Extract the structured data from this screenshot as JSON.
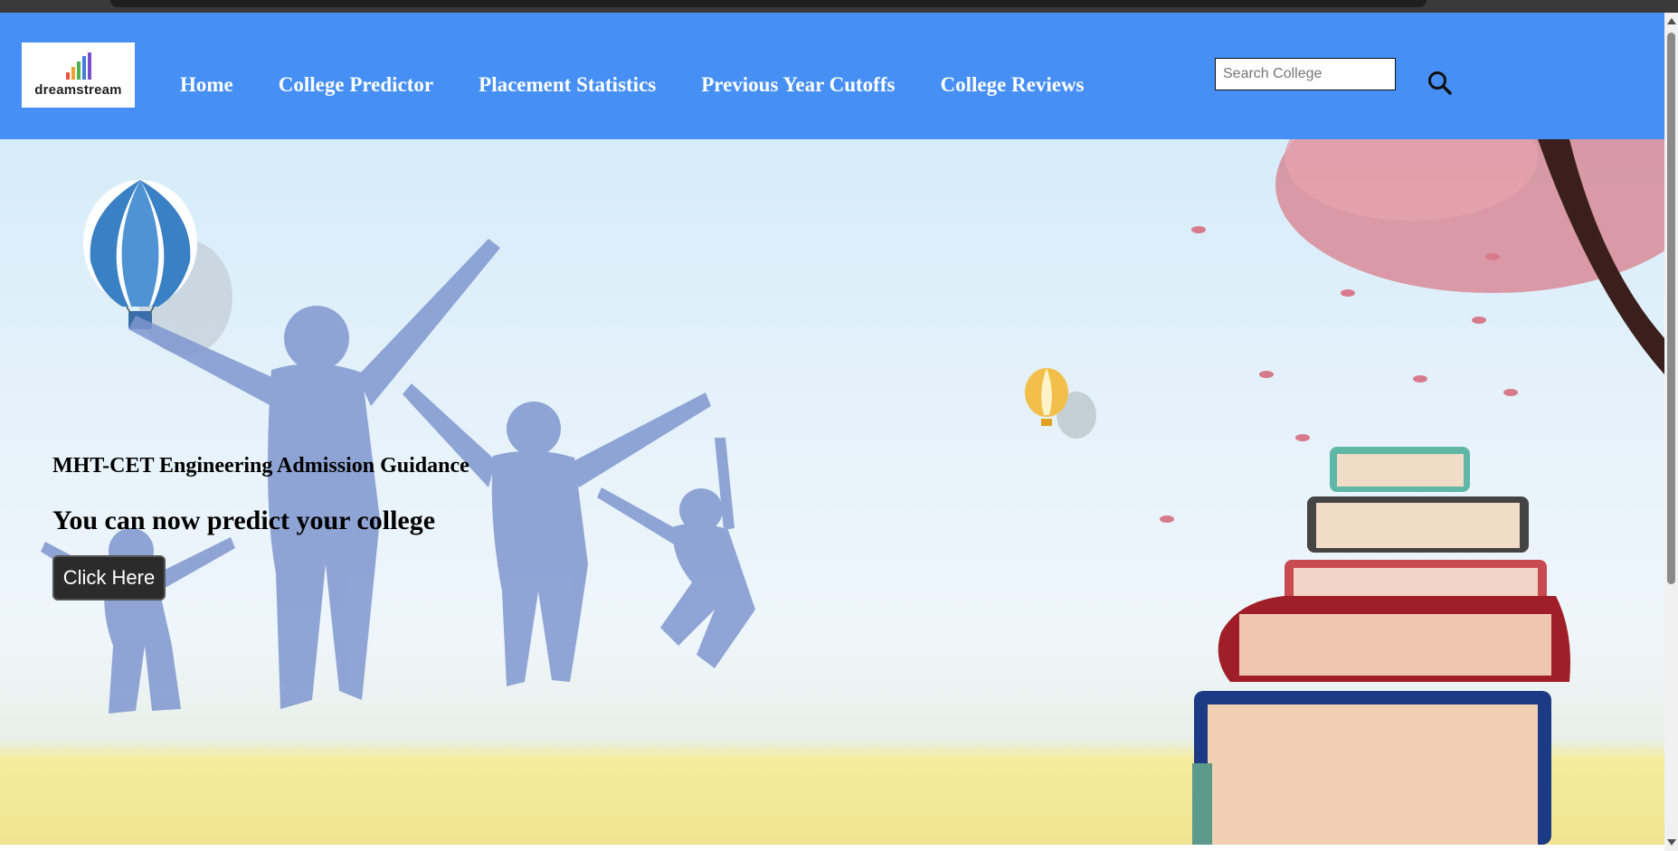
{
  "logo": {
    "text": "dreamstream",
    "bar_colors": [
      "#e8553b",
      "#f0a030",
      "#4caf50",
      "#3f7fd8",
      "#7a4fc9"
    ]
  },
  "nav": {
    "items": [
      {
        "label": "Home"
      },
      {
        "label": "College Predictor"
      },
      {
        "label": "Placement Statistics"
      },
      {
        "label": "Previous Year Cutoffs"
      },
      {
        "label": "College Reviews"
      }
    ]
  },
  "search": {
    "placeholder": "Search College",
    "icon": "search-icon"
  },
  "hero": {
    "eyebrow": "MHT-CET Engineering Admission Guidance",
    "headline": "You can now predict your college",
    "button_label": "Click Here"
  },
  "colors": {
    "navbar": "#468ff5",
    "button": "#2b2b2b"
  }
}
